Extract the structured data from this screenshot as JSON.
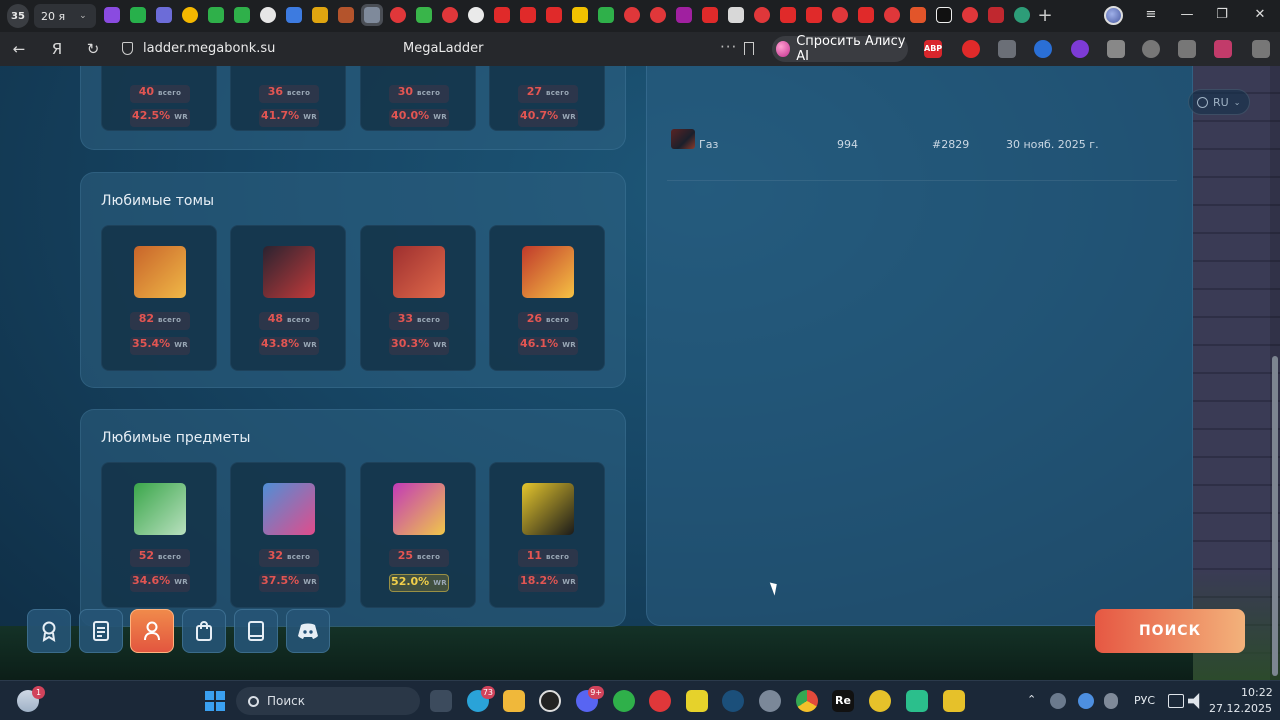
{
  "browser": {
    "tab_count": "35",
    "tab_group_label": "20 я",
    "url": "ladder.megabonk.su",
    "page_title": "MegaLadder",
    "alice_button": "Спросить Алису AI",
    "abp_label": "ABP"
  },
  "page": {
    "tomes_section": {
      "title": "Любимые томы",
      "cards": [
        {
          "icon": "fire-tome-icon",
          "total": "82",
          "wr": "35.4%",
          "good": false,
          "colors": [
            "#c8642a",
            "#f0b847"
          ]
        },
        {
          "icon": "dark-tome-icon",
          "total": "48",
          "wr": "43.8%",
          "good": false,
          "colors": [
            "#2a2330",
            "#c23a3a"
          ]
        },
        {
          "icon": "blood-tome-icon",
          "total": "33",
          "wr": "30.3%",
          "good": false,
          "colors": [
            "#9e2f2f",
            "#e06a4b"
          ]
        },
        {
          "icon": "golden-tome-icon",
          "total": "26",
          "wr": "46.1%",
          "good": false,
          "colors": [
            "#c0392b",
            "#f6c244"
          ]
        }
      ]
    },
    "items_section": {
      "title": "Любимые предметы",
      "cards": [
        {
          "icon": "wrench-icon",
          "total": "52",
          "wr": "34.6%",
          "good": false,
          "colors": [
            "#3aa64a",
            "#b9e0bf"
          ]
        },
        {
          "icon": "syringe-icon",
          "total": "32",
          "wr": "37.5%",
          "good": false,
          "colors": [
            "#4f8fd6",
            "#e14c8b"
          ]
        },
        {
          "icon": "ring-icon",
          "total": "25",
          "wr": "52.0%",
          "good": true,
          "colors": [
            "#c23ab7",
            "#f0c74a"
          ]
        },
        {
          "icon": "bomb-icon",
          "total": "11",
          "wr": "18.2%",
          "good": false,
          "colors": [
            "#e5c62d",
            "#1a1a1a"
          ]
        }
      ]
    },
    "top_partial_cards": [
      {
        "total": "40",
        "wr": "42.5%"
      },
      {
        "total": "36",
        "wr": "41.7%"
      },
      {
        "total": "30",
        "wr": "40.0%"
      },
      {
        "total": "27",
        "wr": "40.7%"
      }
    ],
    "labels": {
      "total": "всего",
      "wr": "WR"
    },
    "match_row": {
      "name": "Газ",
      "score": "994",
      "rank": "#2829",
      "date": "30 нояб. 2025 г."
    },
    "lang": "RU",
    "search_button": "ПОИСК"
  },
  "taskbar": {
    "search_placeholder": "Поиск",
    "telegram_badge": "73",
    "discord_badge": "9+",
    "weather_badge": "1",
    "lang": "РУС",
    "time": "10:22",
    "date": "27.12.2025"
  }
}
